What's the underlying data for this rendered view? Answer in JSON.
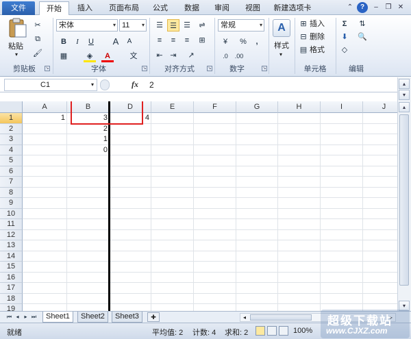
{
  "tabs": {
    "file": "文件",
    "items": [
      "开始",
      "插入",
      "页面布局",
      "公式",
      "数据",
      "审阅",
      "视图",
      "新建选项卡"
    ]
  },
  "ribbon": {
    "clipboard": {
      "paste": "粘贴",
      "label": "剪贴板"
    },
    "font": {
      "name": "宋体",
      "size": "11",
      "label": "字体",
      "bold": "B",
      "italic": "I",
      "underline": "U",
      "grow": "A",
      "shrink": "A",
      "fontcolor": "A",
      "wen": "文"
    },
    "align": {
      "label": "对齐方式"
    },
    "number": {
      "format": "常规",
      "label": "数字",
      "percent": "%",
      "comma": ","
    },
    "styles": {
      "label": "样式"
    },
    "cells": {
      "insert": "插入",
      "delete": "删除",
      "format": "格式",
      "label": "单元格"
    },
    "editing": {
      "sum": "Σ",
      "label": "编辑"
    }
  },
  "formula_bar": {
    "name_box": "C1",
    "fx": "fx",
    "value": "2"
  },
  "columns": [
    "A",
    "B",
    "D",
    "E",
    "F",
    "G",
    "H",
    "I",
    "J"
  ],
  "rows": [
    "1",
    "2",
    "3",
    "4",
    "5",
    "6",
    "7",
    "8",
    "9",
    "10",
    "11",
    "12",
    "13",
    "14",
    "15",
    "16",
    "17",
    "18",
    "19"
  ],
  "cells": {
    "A1": "1",
    "B1": "3",
    "B2": "2",
    "B3": "1",
    "B4": "0",
    "D1": "4"
  },
  "sheets": [
    "Sheet1",
    "Sheet2",
    "Sheet3"
  ],
  "status": {
    "ready": "就绪",
    "average": "平均值: 2",
    "count": "计数: 4",
    "sum": "求和: 2",
    "zoom": "100%"
  },
  "watermark": {
    "title": "超级下载站",
    "url": "www.CJXZ.com"
  },
  "colors": {
    "accent": "#2a5fab",
    "highlight_box": "#e02020",
    "selected_header": "#f4c65c"
  }
}
